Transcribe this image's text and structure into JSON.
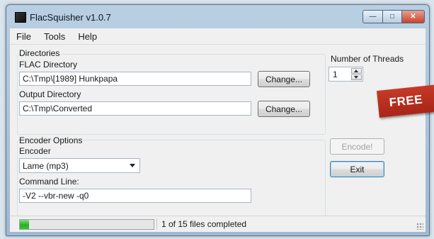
{
  "window": {
    "title": "FlacSquisher v1.0.7"
  },
  "title_buttons": {
    "minimize": "—",
    "maximize": "□",
    "close": "✕"
  },
  "menu": [
    "File",
    "Tools",
    "Help"
  ],
  "directories": {
    "group_label": "Directories",
    "flac_label": "FLAC Directory",
    "flac_value": "C:\\Tmp\\[1989] Hunkpapa",
    "output_label": "Output Directory",
    "output_value": "C:\\Tmp\\Converted",
    "change_label": "Change..."
  },
  "threads": {
    "label": "Number of Threads",
    "value": "1"
  },
  "encoder_options": {
    "group_label": "Encoder Options",
    "encoder_label": "Encoder",
    "encoder_value": "Lame (mp3)",
    "cmd_label": "Command Line:",
    "cmd_value": "-V2 --vbr-new -q0"
  },
  "actions": {
    "encode_label": "Encode!",
    "exit_label": "Exit"
  },
  "badge": {
    "text": "FREE"
  },
  "status": {
    "text": "1 of 15 files completed",
    "progress_fraction": 0.067
  },
  "colors": {
    "progress": "#27b022",
    "badge": "#b82c1c"
  }
}
